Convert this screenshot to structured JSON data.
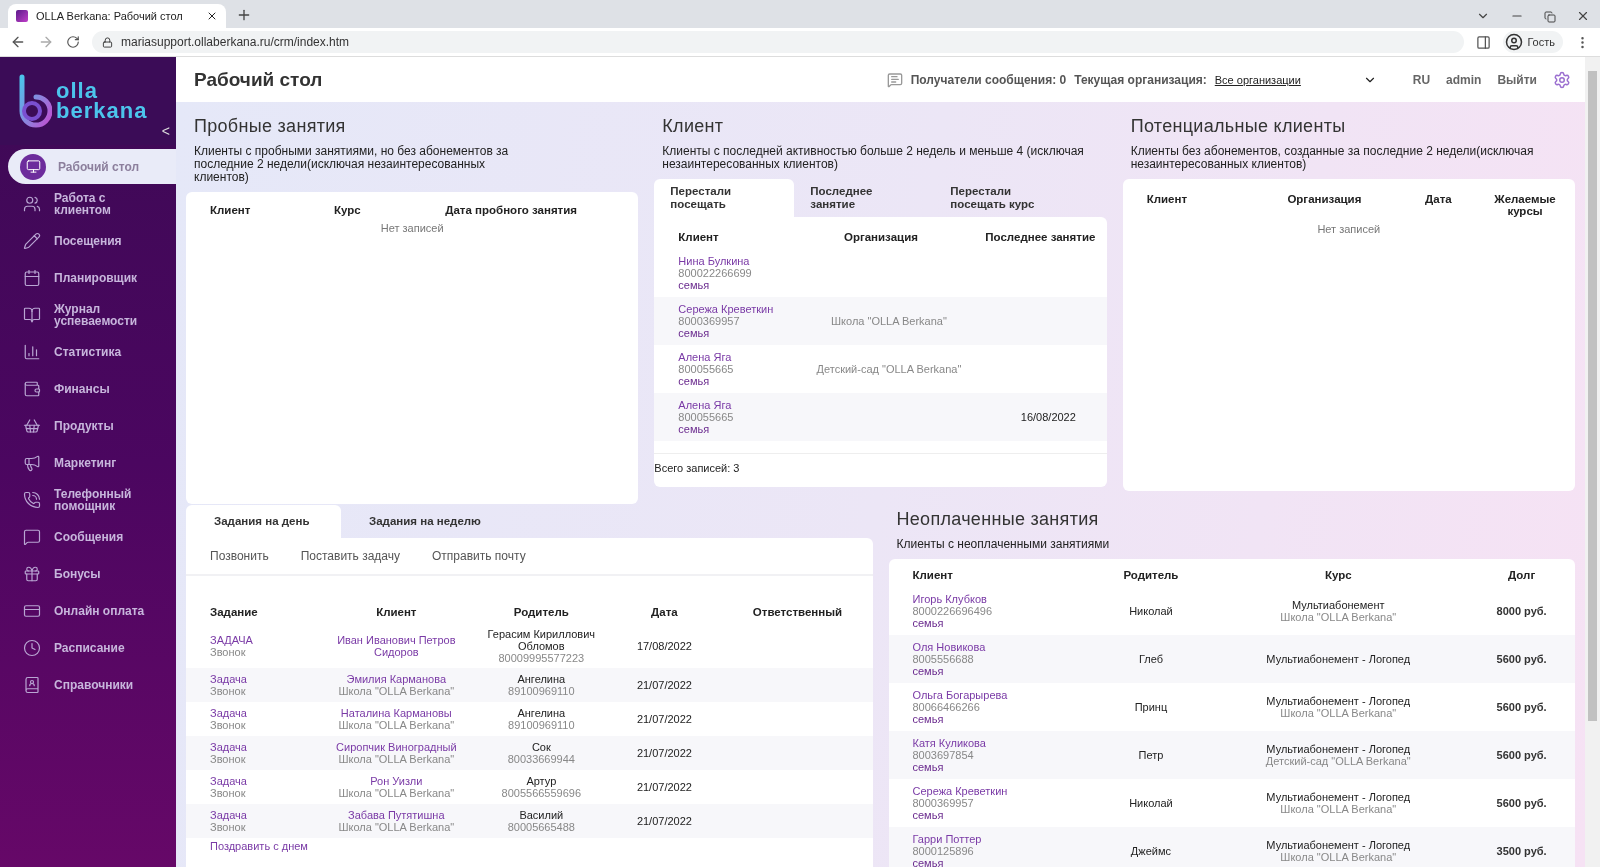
{
  "browser": {
    "tab_title": "OLLA Berkana: Рабочий стол",
    "url": "mariasupport.ollaberkana.ru/crm/index.htm",
    "profile": "Гость"
  },
  "logo": {
    "line_1": "olla",
    "line_2": "berkana",
    "collapse": "<"
  },
  "sidebar": {
    "items": [
      {
        "label": "Рабочий стол",
        "selected": true
      },
      {
        "label": "Работа с клиентом",
        "selected": false
      },
      {
        "label": "Посещения",
        "selected": false
      },
      {
        "label": "Планировщик",
        "selected": false
      },
      {
        "label": "Журнал успеваемости",
        "selected": false
      },
      {
        "label": "Статистика",
        "selected": false
      },
      {
        "label": "Финансы",
        "selected": false
      },
      {
        "label": "Продукты",
        "selected": false
      },
      {
        "label": "Маркетинг",
        "selected": false
      },
      {
        "label": "Телефонный помощник",
        "selected": false
      },
      {
        "label": "Сообщения",
        "selected": false
      },
      {
        "label": "Бонусы",
        "selected": false
      },
      {
        "label": "Онлайн оплата",
        "selected": false
      },
      {
        "label": "Расписание",
        "selected": false
      },
      {
        "label": "Справочники",
        "selected": false
      }
    ]
  },
  "header": {
    "title": "Рабочий стол",
    "recipients": "Получатели сообщения: 0",
    "org_label": "Текущая организация:",
    "org_value": "Все организации",
    "language": "RU",
    "user": "admin",
    "logout": "Выйти"
  },
  "trial": {
    "title": "Пробные занятия",
    "description": "Клиенты с пробными занятиями, но без абонементов за последние 2 недели(исключая незаинтересованных клиентов)",
    "columns": [
      "Клиент",
      "Курс",
      "Дата пробного занятия"
    ],
    "empty": "Нет записей"
  },
  "clients": {
    "title": "Клиент",
    "description": "Клиенты с последней активностью больше 2 недель и меньше 4 (исключая незаинтересованных клиентов)",
    "tabs": [
      {
        "label": "Перестали посещать",
        "selected": true
      },
      {
        "label": "Последнее занятие",
        "selected": false
      },
      {
        "label": "Перестали посещать курс",
        "selected": false
      }
    ],
    "columns": [
      "Клиент",
      "Организация",
      "Последнее занятие"
    ],
    "rows": [
      {
        "name": "Нина Булкина",
        "phone": "800022266699",
        "tag": "семья",
        "organization": "",
        "last": ""
      },
      {
        "name": "Сережа Креветкин",
        "phone": "8000369957",
        "tag": "семья",
        "organization": "Школа \"OLLA Berkana\"",
        "last": ""
      },
      {
        "name": "Алена Яга",
        "phone": "800055665",
        "tag": "семья",
        "organization": "Детский-сад \"OLLA Berkana\"",
        "last": ""
      },
      {
        "name": "Алена Яга",
        "phone": "800055665",
        "tag": "семья",
        "organization": "",
        "last": "16/08/2022"
      }
    ],
    "total": "Всего записей: 3"
  },
  "potential": {
    "title": "Потенциальные клиенты",
    "description": "Клиенты без абонементов, созданные за последние 2 недели(исключая незаинтересованных клиентов)",
    "columns": [
      "Клиент",
      "Организация",
      "Дата",
      "Желаемые курсы"
    ],
    "empty": "Нет записей"
  },
  "tasks": {
    "tabs": [
      {
        "label": "Задания на день",
        "selected": true
      },
      {
        "label": "Задания на неделю",
        "selected": false
      }
    ],
    "actions": [
      "Позвонить",
      "Поставить задачу",
      "Отправить почту"
    ],
    "columns": [
      "Задание",
      "Клиент",
      "Родитель",
      "Дата",
      "Ответственный"
    ],
    "rows": [
      {
        "task": "ЗАДАЧА",
        "type": "Звонок",
        "client": "Иван Иванович Петров Сидоров",
        "client_org": "",
        "parent": "Герасим Кириллович Обломов",
        "parent_phone": "80009995577223",
        "date": "17/08/2022"
      },
      {
        "task": "Задача",
        "type": "Звонок",
        "client": "Эмилия Карманова",
        "client_org": "Школа \"OLLA Berkana\"",
        "parent": "Ангелина",
        "parent_phone": "89100969110",
        "date": "21/07/2022"
      },
      {
        "task": "Задача",
        "type": "Звонок",
        "client": "Наталина Кармановы",
        "client_org": "Школа \"OLLA Berkana\"",
        "parent": "Ангелина",
        "parent_phone": "89100969110",
        "date": "21/07/2022"
      },
      {
        "task": "Задача",
        "type": "Звонок",
        "client": "Сиропчик Виноградный",
        "client_org": "Школа \"OLLA Berkana\"",
        "parent": "Сок",
        "parent_phone": "80033669944",
        "date": "21/07/2022"
      },
      {
        "task": "Задача",
        "type": "Звонок",
        "client": "Рон Уизли",
        "client_org": "Школа \"OLLA Berkana\"",
        "parent": "Артур",
        "parent_phone": "8005566559696",
        "date": "21/07/2022"
      },
      {
        "task": "Задача",
        "type": "Звонок",
        "client": "Забава Путятишна",
        "client_org": "Школа \"OLLA Berkana\"",
        "parent": "Василий",
        "parent_phone": "80005665488",
        "date": "21/07/2022"
      }
    ],
    "next_row": "Поздравить с днем"
  },
  "unpaid": {
    "title": "Неоплаченные занятия",
    "description": "Клиенты с неоплаченными занятиями",
    "columns": [
      "Клиент",
      "Родитель",
      "Курс",
      "Долг"
    ],
    "rows": [
      {
        "name": "Игорь Клубков",
        "phone": "8000226696496",
        "tag": "семья",
        "parent": "Николай",
        "course": "Мультиабонемент",
        "org": "Школа \"OLLA Berkana\"",
        "debt": "8000 руб."
      },
      {
        "name": "Оля Новикова",
        "phone": "8005556688",
        "tag": "семья",
        "parent": "Глеб",
        "course": "Мультиабонемент - Логопед",
        "org": "",
        "debt": "5600 руб."
      },
      {
        "name": "Ольга Богарырева",
        "phone": "80066466266",
        "tag": "семья",
        "parent": "Принц",
        "course": "Мультиабонемент - Логопед",
        "org": "Школа \"OLLA Berkana\"",
        "debt": "5600 руб."
      },
      {
        "name": "Катя Куликова",
        "phone": "8003697854",
        "tag": "семья",
        "parent": "Петр",
        "course": "Мультиабонемент - Логопед",
        "org": "Детский-сад \"OLLA Berkana\"",
        "debt": "5600 руб."
      },
      {
        "name": "Сережа Креветкин",
        "phone": "8000369957",
        "tag": "семья",
        "parent": "Николай",
        "course": "Мультиабонемент - Логопед",
        "org": "Школа \"OLLA Berkana\"",
        "debt": "5600 руб."
      },
      {
        "name": "Гарри Поттер",
        "phone": "8000125896",
        "tag": "семья",
        "parent": "Джеймс",
        "course": "Мультиабонемент - Логопед",
        "org": "Школа \"OLLA Berkana\"",
        "debt": "3500 руб."
      }
    ]
  }
}
